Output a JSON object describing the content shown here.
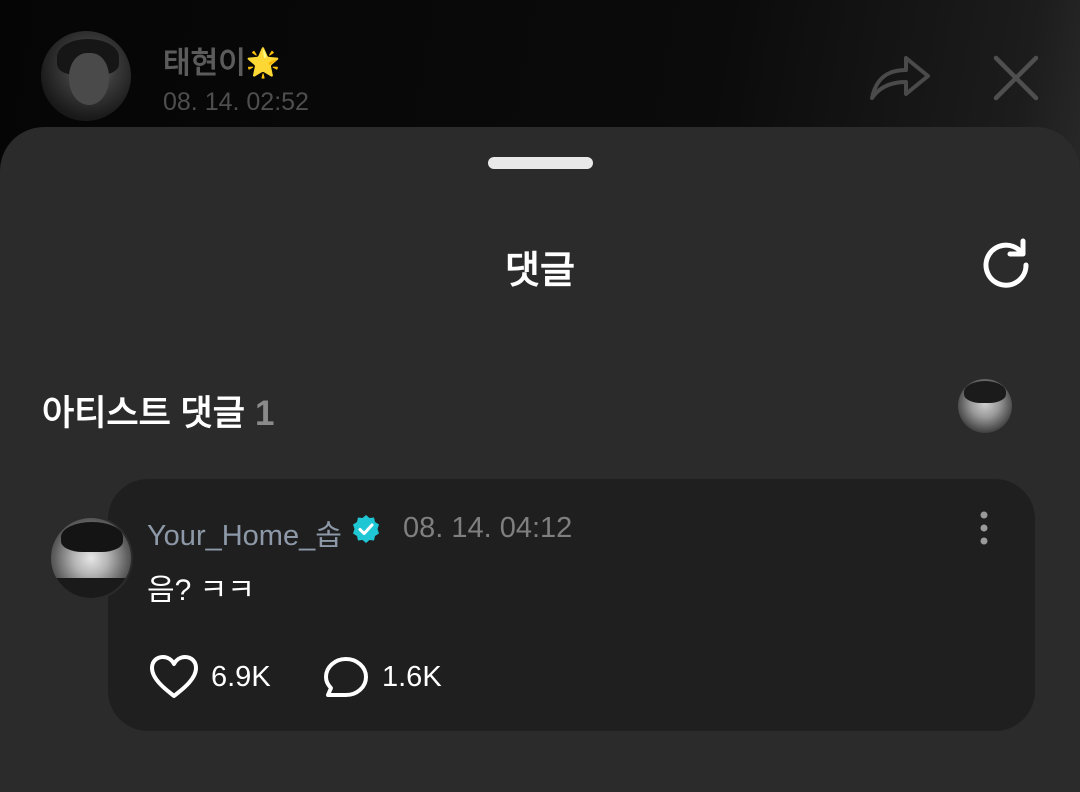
{
  "post": {
    "author_name": "태현이",
    "author_emoji": "🌟",
    "timestamp": "08. 14. 02:52"
  },
  "icons": {
    "share": "share-arrow-icon",
    "close": "close-x-icon",
    "refresh": "refresh-icon",
    "verified": "verified-badge-icon",
    "more": "more-vertical-icon",
    "like": "heart-outline-icon",
    "reply": "comment-bubble-icon"
  },
  "colors": {
    "sheet_bg": "#2b2b2b",
    "card_bg": "#1f1f1f",
    "verified_badge": "#1fc7d4",
    "author_name": "#8d99a8"
  },
  "sheet": {
    "title": "댓글",
    "section_title": "아티스트 댓글",
    "section_count": "1"
  },
  "comment": {
    "author": "Your_Home_솝",
    "timestamp": "08. 14. 04:12",
    "text": "음? ㅋㅋ",
    "likes": "6.9K",
    "replies": "1.6K"
  }
}
